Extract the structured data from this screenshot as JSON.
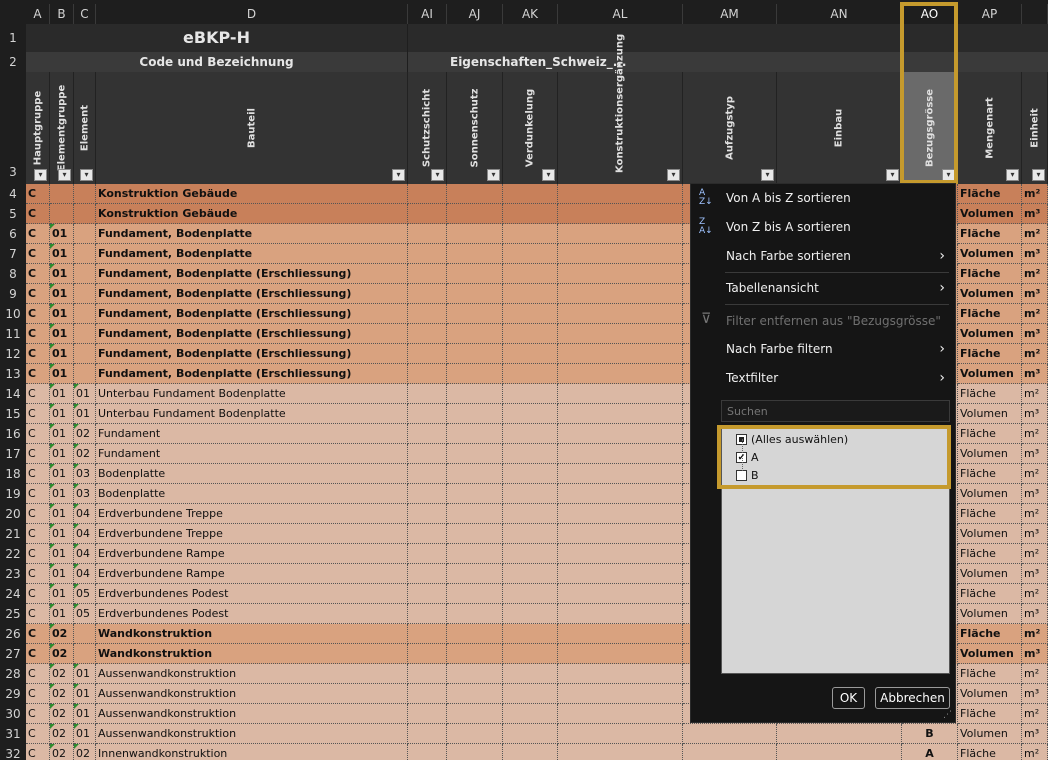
{
  "columns": [
    "A",
    "B",
    "C",
    "D",
    "AI",
    "AJ",
    "AK",
    "AL",
    "AM",
    "AN",
    "AO",
    "AP",
    ""
  ],
  "rows": [
    "1",
    "2",
    "3",
    "4",
    "5",
    "6",
    "7",
    "8",
    "9",
    "10",
    "11",
    "12",
    "13",
    "14",
    "15",
    "16",
    "17",
    "18",
    "19",
    "20",
    "21",
    "22",
    "23",
    "24",
    "25",
    "26",
    "27",
    "28",
    "29",
    "30",
    "31",
    "32"
  ],
  "row1_title": "eBKP-H",
  "row2_left": "Code und Bezeichnung",
  "row2_right": "Eigenschaften_Schweiz_...",
  "headers": {
    "hg": "Hauptgruppe",
    "eg": "Elementgruppe",
    "el": "Element",
    "bt": "Bauteil",
    "ai": "Schutzschicht",
    "aj": "Sonnenschutz",
    "ak": "Verdunkelung",
    "al": "Konstruktionsergänzung",
    "am": "Aufzugstyp",
    "an": "Einbau",
    "ao": "Bezugsgrösse",
    "ap": "Mengenart",
    "aq": "Einheit"
  },
  "data_rows": [
    {
      "a": "C",
      "b": "",
      "c": "",
      "d": "Konstruktion Gebäude",
      "ap": "Fläche",
      "aq": "m²",
      "kind": "h1"
    },
    {
      "a": "C",
      "b": "",
      "c": "",
      "d": "Konstruktion Gebäude",
      "ap": "Volumen",
      "aq": "m³",
      "kind": "h1"
    },
    {
      "a": "C",
      "b": "01",
      "c": "",
      "d": "Fundament, Bodenplatte",
      "ap": "Fläche",
      "aq": "m²",
      "kind": "h2"
    },
    {
      "a": "C",
      "b": "01",
      "c": "",
      "d": "Fundament, Bodenplatte",
      "ap": "Volumen",
      "aq": "m³",
      "kind": "h2"
    },
    {
      "a": "C",
      "b": "01",
      "c": "",
      "d": "Fundament, Bodenplatte (Erschliessung)",
      "ap": "Fläche",
      "aq": "m²",
      "kind": "h2"
    },
    {
      "a": "C",
      "b": "01",
      "c": "",
      "d": "Fundament, Bodenplatte (Erschliessung)",
      "ap": "Volumen",
      "aq": "m³",
      "kind": "h2"
    },
    {
      "a": "C",
      "b": "01",
      "c": "",
      "d": "Fundament, Bodenplatte (Erschliessung)",
      "ap": "Fläche",
      "aq": "m²",
      "kind": "h2"
    },
    {
      "a": "C",
      "b": "01",
      "c": "",
      "d": "Fundament, Bodenplatte (Erschliessung)",
      "ap": "Volumen",
      "aq": "m³",
      "kind": "h2"
    },
    {
      "a": "C",
      "b": "01",
      "c": "",
      "d": "Fundament, Bodenplatte (Erschliessung)",
      "ap": "Fläche",
      "aq": "m²",
      "kind": "h2"
    },
    {
      "a": "C",
      "b": "01",
      "c": "",
      "d": "Fundament, Bodenplatte (Erschliessung)",
      "ap": "Volumen",
      "aq": "m³",
      "kind": "h2"
    },
    {
      "a": "C",
      "b": "01",
      "c": "01",
      "d": "Unterbau Fundament Bodenplatte",
      "ap": "Fläche",
      "aq": "m²",
      "kind": "n"
    },
    {
      "a": "C",
      "b": "01",
      "c": "01",
      "d": "Unterbau Fundament Bodenplatte",
      "ap": "Volumen",
      "aq": "m³",
      "kind": "n"
    },
    {
      "a": "C",
      "b": "01",
      "c": "02",
      "d": "Fundament",
      "ap": "Fläche",
      "aq": "m²",
      "kind": "n"
    },
    {
      "a": "C",
      "b": "01",
      "c": "02",
      "d": "Fundament",
      "ap": "Volumen",
      "aq": "m³",
      "kind": "n"
    },
    {
      "a": "C",
      "b": "01",
      "c": "03",
      "d": "Bodenplatte",
      "ap": "Fläche",
      "aq": "m²",
      "kind": "n"
    },
    {
      "a": "C",
      "b": "01",
      "c": "03",
      "d": "Bodenplatte",
      "ap": "Volumen",
      "aq": "m³",
      "kind": "n"
    },
    {
      "a": "C",
      "b": "01",
      "c": "04",
      "d": "Erdverbundene Treppe",
      "ap": "Fläche",
      "aq": "m²",
      "kind": "n"
    },
    {
      "a": "C",
      "b": "01",
      "c": "04",
      "d": "Erdverbundene Treppe",
      "ap": "Volumen",
      "aq": "m³",
      "kind": "n"
    },
    {
      "a": "C",
      "b": "01",
      "c": "04",
      "d": "Erdverbundene Rampe",
      "ap": "Fläche",
      "aq": "m²",
      "kind": "n"
    },
    {
      "a": "C",
      "b": "01",
      "c": "04",
      "d": "Erdverbundene Rampe",
      "ap": "Volumen",
      "aq": "m³",
      "kind": "n"
    },
    {
      "a": "C",
      "b": "01",
      "c": "05",
      "d": "Erdverbundenes Podest",
      "ap": "Fläche",
      "aq": "m²",
      "kind": "n"
    },
    {
      "a": "C",
      "b": "01",
      "c": "05",
      "d": "Erdverbundenes Podest",
      "ap": "Volumen",
      "aq": "m³",
      "kind": "n"
    },
    {
      "a": "C",
      "b": "02",
      "c": "",
      "d": "Wandkonstruktion",
      "ap": "Fläche",
      "aq": "m²",
      "kind": "h2"
    },
    {
      "a": "C",
      "b": "02",
      "c": "",
      "d": "Wandkonstruktion",
      "ap": "Volumen",
      "aq": "m³",
      "kind": "h2"
    },
    {
      "a": "C",
      "b": "02",
      "c": "01",
      "d": "Aussenwandkonstruktion",
      "ap": "Fläche",
      "aq": "m²",
      "kind": "n"
    },
    {
      "a": "C",
      "b": "02",
      "c": "01",
      "d": "Aussenwandkonstruktion",
      "ap": "Volumen",
      "aq": "m³",
      "kind": "n"
    },
    {
      "a": "C",
      "b": "02",
      "c": "01",
      "d": "Aussenwandkonstruktion",
      "ap": "Fläche",
      "aq": "m²",
      "kind": "n"
    },
    {
      "a": "C",
      "b": "02",
      "c": "01",
      "d": "Aussenwandkonstruktion",
      "ap": "Volumen",
      "aq": "m³",
      "kind": "n",
      "ao": "B"
    },
    {
      "a": "C",
      "b": "02",
      "c": "02",
      "d": "Innenwandkonstruktion",
      "ap": "Fläche",
      "aq": "m²",
      "kind": "n",
      "ao": "A"
    }
  ],
  "menu": {
    "sort_az": "Von A bis Z sortieren",
    "sort_za": "Von Z bis A sortieren",
    "sort_color": "Nach Farbe sortieren",
    "table_view": "Tabellenansicht",
    "clear_filter": "Filter entfernen aus \"Bezugsgrösse\"",
    "filter_color": "Nach Farbe filtern",
    "text_filter": "Textfilter",
    "search_placeholder": "Suchen",
    "items": [
      {
        "label": "(Alles auswählen)",
        "state": "partial"
      },
      {
        "label": "A",
        "state": "checked"
      },
      {
        "label": "B",
        "state": "unchecked"
      }
    ],
    "ok": "OK",
    "cancel": "Abbrechen"
  },
  "colors": {
    "h1": "#c8805a",
    "h2": "#d9a27f",
    "n": "#dbb8a4",
    "highlight": "#c59a2d"
  }
}
